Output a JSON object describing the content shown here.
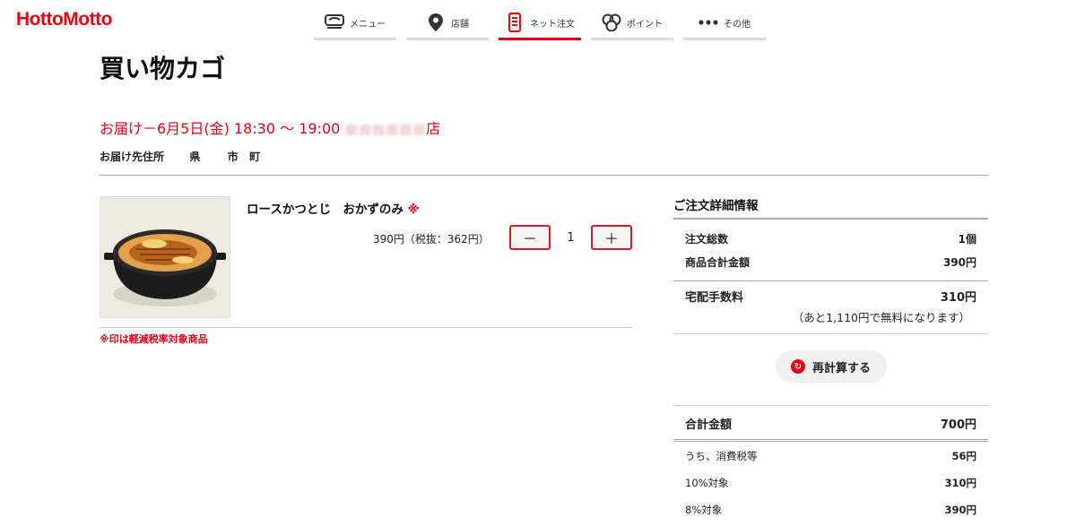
{
  "brand": "HottoMotto",
  "nav": [
    {
      "label": "メニュー",
      "icon": "menu-bowl-icon",
      "active": false
    },
    {
      "label": "店舗",
      "icon": "location-pin-icon",
      "active": false
    },
    {
      "label": "ネット注文",
      "icon": "smartphone-icon",
      "active": true
    },
    {
      "label": "ポイント",
      "icon": "coins-icon",
      "active": false
    },
    {
      "label": "その他",
      "icon": "more-dots-icon",
      "active": false
    }
  ],
  "page_title": "買い物カゴ",
  "delivery": {
    "text": "お届け－6月5日(金) 18:30 ～ 19:00 ",
    "store_suffix": "店",
    "address_label": "お届け先住所",
    "address_parts": [
      "県",
      "市",
      "町"
    ]
  },
  "cart_item": {
    "name": "ロースかつとじ　おかずのみ",
    "reduced_mark": "※",
    "price": "390円（税抜：362円）",
    "quantity": "1",
    "minus": "－",
    "plus": "＋"
  },
  "note": "※印は軽減税率対象商品",
  "summary": {
    "title": "ご注文詳細情報",
    "total_count_label": "注文総数",
    "total_count_value": "1個",
    "subtotal_label": "商品合計金額",
    "subtotal_value": "390円",
    "delivery_fee_label": "宅配手数料",
    "delivery_fee_value": "310円",
    "free_note": "（あと1,110円で無料になります）",
    "recalc_label": "再計算する",
    "grand_total_label": "合計金額",
    "grand_total_value": "700円",
    "tax_label": "うち、消費税等",
    "tax_value": "56円",
    "ten_pct_label": "10%対象",
    "ten_pct_value": "310円",
    "eight_pct_label": "8%対象",
    "eight_pct_value": "390円"
  },
  "colors": {
    "brand_red": "#e60012",
    "rule_gray": "#aaaaaa"
  }
}
